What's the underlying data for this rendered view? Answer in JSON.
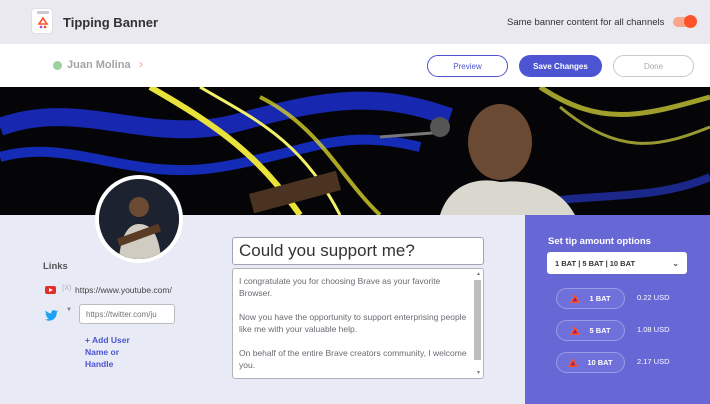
{
  "app": {
    "title": "Tipping Banner",
    "icon": "brave-rewards-jar-icon"
  },
  "settings": {
    "same_content_label": "Same banner content for all channels",
    "same_content_on": true
  },
  "header": {
    "creator_name": "Juan Molina",
    "verified": true,
    "buttons": {
      "preview": "Preview",
      "save": "Save Changes",
      "done": "Done"
    }
  },
  "banner": {
    "description": "performer with guitar and microphone, yellow and blue light streaks"
  },
  "links": {
    "title": "Links",
    "youtube": {
      "icon": "youtube-icon",
      "remove": "(X)",
      "url": "https://www.youtube.com/"
    },
    "twitter": {
      "icon": "twitter-icon",
      "placeholder": "https://twitter.com/ju"
    },
    "add_label": "+ Add User Name or Handle"
  },
  "message": {
    "title": "Could you support me?",
    "paragraphs": [
      "I congratulate you for choosing Brave as your favorite Browser.",
      "Now you have the opportunity to support enterprising people like me with your valuable help.",
      "On behalf of the entire Brave creators community, I welcome you."
    ]
  },
  "tips": {
    "title": "Set tip amount options",
    "selected": "1 BAT  |  5 BAT  |  10 BAT",
    "options": [
      {
        "bat": "1 BAT",
        "usd": "0.22 USD"
      },
      {
        "bat": "5 BAT",
        "usd": "1.08 USD"
      },
      {
        "bat": "10 BAT",
        "usd": "2.17 USD"
      }
    ]
  },
  "colors": {
    "accent": "#4c54d2",
    "brave_orange": "#fb542b",
    "tip_panel": "#6767d6"
  }
}
